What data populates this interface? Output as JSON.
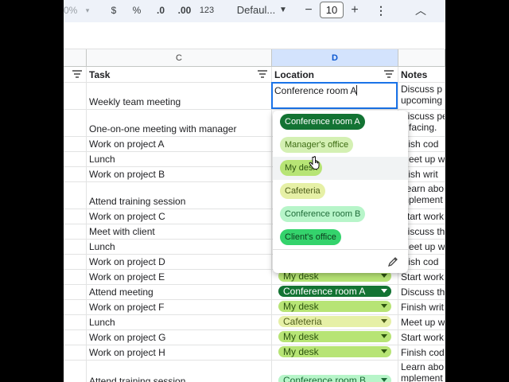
{
  "toolbar": {
    "percent_partial": "0%",
    "dollar": "$",
    "percent": "%",
    "dec_decrease": ".0",
    "dec_increase": ".00",
    "number_format": "123",
    "font": "Defaul...",
    "minus": "−",
    "font_size": "10",
    "plus": "+",
    "more": "⋮",
    "collapse": "^"
  },
  "columns": {
    "c": "C",
    "d": "D"
  },
  "header": {
    "task": "Task",
    "location": "Location",
    "notes": "Notes"
  },
  "editor": {
    "value": "Conference room A"
  },
  "dropdown": {
    "options": [
      {
        "label": "Conference room A",
        "bg": "#137333",
        "fg": "#ffffff"
      },
      {
        "label": "Manager's office",
        "bg": "#d4f0b3",
        "fg": "#3c6b12"
      },
      {
        "label": "My desk",
        "bg": "#b7e475",
        "fg": "#2d5410"
      },
      {
        "label": "Cafeteria",
        "bg": "#e6f0a6",
        "fg": "#4d5d1a"
      },
      {
        "label": "Conference room B",
        "bg": "#b7f5c9",
        "fg": "#1e6b38"
      },
      {
        "label": "Client's office",
        "bg": "#34d36c",
        "fg": "#0d3b1c"
      }
    ]
  },
  "rows": [
    {
      "task": "Weekly team meeting",
      "location": "",
      "n1": "Discuss p",
      "n2": "upcoming"
    },
    {
      "task": "One-on-one meeting with manager",
      "location": "",
      "n1": "Discuss pe",
      "n2": "n facing."
    },
    {
      "task": "Work on project A",
      "location": "",
      "n1": "inish cod",
      "n2": ""
    },
    {
      "task": "Lunch",
      "location": "",
      "n1": "Meet up w",
      "n2": ""
    },
    {
      "task": "Work on project B",
      "location": "",
      "n1": "inish writ",
      "n2": ""
    },
    {
      "task": "Attend training session",
      "location": "",
      "n1": "Learn abo",
      "n2": "mplement"
    },
    {
      "task": "Work on project C",
      "location": "",
      "n1": "Start work",
      "n2": ""
    },
    {
      "task": "Meet with client",
      "location": "",
      "n1": "Discuss th",
      "n2": ""
    },
    {
      "task": "Lunch",
      "location": "",
      "n1": "Meet up w",
      "n2": ""
    },
    {
      "task": "Work on project D",
      "location": "",
      "n1": "inish cod",
      "n2": ""
    },
    {
      "task": "Work on project E",
      "location": "My desk",
      "n1": "Start work",
      "n2": ""
    },
    {
      "task": "Attend meeting",
      "location": "Conference room A",
      "n1": "Discuss th",
      "n2": ""
    },
    {
      "task": "Work on project F",
      "location": "My desk",
      "n1": "Finish writ",
      "n2": ""
    },
    {
      "task": "Lunch",
      "location": "Cafeteria",
      "n1": "Meet up w",
      "n2": ""
    },
    {
      "task": "Work on project G",
      "location": "My desk",
      "n1": "Start work",
      "n2": ""
    },
    {
      "task": "Work on project H",
      "location": "My desk",
      "n1": "Finish cod",
      "n2": ""
    },
    {
      "task": "Attend training session",
      "location": "Conference room B",
      "n1": "Learn abo",
      "n2": "mplement"
    }
  ],
  "chip_colors": {
    "My desk": {
      "bg": "#b7e475",
      "fg": "#2d5410",
      "arrow": "#2d5410"
    },
    "Conference room A": {
      "bg": "#137333",
      "fg": "#ffffff",
      "arrow": "#ffffff"
    },
    "Cafeteria": {
      "bg": "#e6f0a6",
      "fg": "#4d5d1a",
      "arrow": "#4d5d1a"
    },
    "Conference room B": {
      "bg": "#b7f5c9",
      "fg": "#1e6b38",
      "arrow": "#1e6b38"
    }
  }
}
